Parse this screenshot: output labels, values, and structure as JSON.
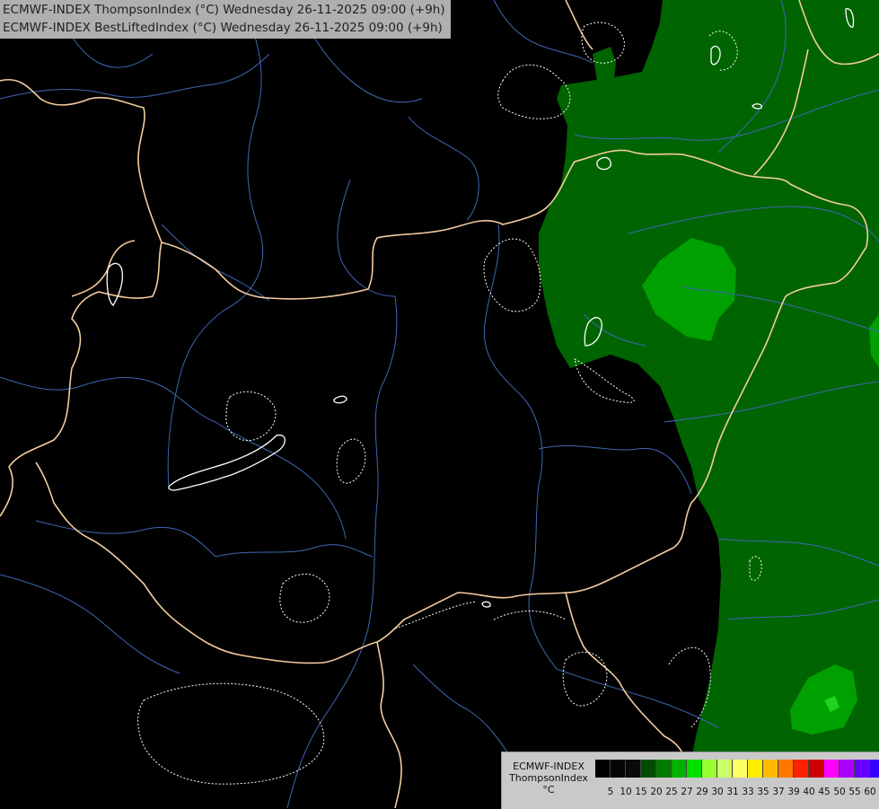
{
  "header": {
    "line1": "ECMWF-INDEX ThompsonIndex (°C) Wednesday 26-11-2025 09:00 (+9h)",
    "line2": "ECMWF-INDEX BestLiftedIndex (°C) Wednesday 26-11-2025 09:00 (+9h)"
  },
  "legend": {
    "source": "ECMWF-INDEX",
    "variable": "ThompsonIndex",
    "unit": "°C",
    "ticks": [
      "5",
      "10",
      "15",
      "20",
      "25",
      "27",
      "29",
      "30",
      "31",
      "33",
      "35",
      "37",
      "39",
      "40",
      "45",
      "50",
      "55",
      "60"
    ],
    "colors": [
      "#000000",
      "#050505",
      "#0a0a0a",
      "#004d00",
      "#007a00",
      "#00b000",
      "#00e000",
      "#99ff33",
      "#ccff66",
      "#ffff66",
      "#ffee00",
      "#ffbb00",
      "#ff7700",
      "#ff2200",
      "#cc0000",
      "#ff00ff",
      "#aa00ff",
      "#6600ff",
      "#3300ff",
      "#0000ff"
    ]
  },
  "map": {
    "colors": {
      "background": "#000000",
      "field_low": "#006400",
      "field_mid": "#00a000",
      "field_high": "#1ed41e",
      "borders": "#f2cc9e",
      "rivers": "#3f67b5",
      "contours": "#ffffff"
    }
  }
}
